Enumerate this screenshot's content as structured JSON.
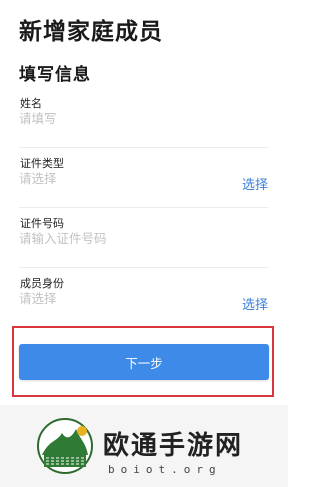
{
  "page": {
    "title": "新增家庭成员"
  },
  "section": {
    "title": "填写信息"
  },
  "fields": [
    {
      "label": "姓名",
      "placeholder": "请填写",
      "action": ""
    },
    {
      "label": "证件类型",
      "placeholder": "请选择",
      "action": "选择"
    },
    {
      "label": "证件号码",
      "placeholder": "请输入证件号码",
      "action": ""
    },
    {
      "label": "成员身份",
      "placeholder": "请选择",
      "action": "选择"
    }
  ],
  "actions": {
    "next_label": "下一步"
  },
  "watermark": {
    "title": "欧通手游网",
    "subtitle": "boiot.org"
  },
  "colors": {
    "accent": "#3e8ae9",
    "link": "#3a7fd6",
    "highlight": "#d9363e"
  }
}
